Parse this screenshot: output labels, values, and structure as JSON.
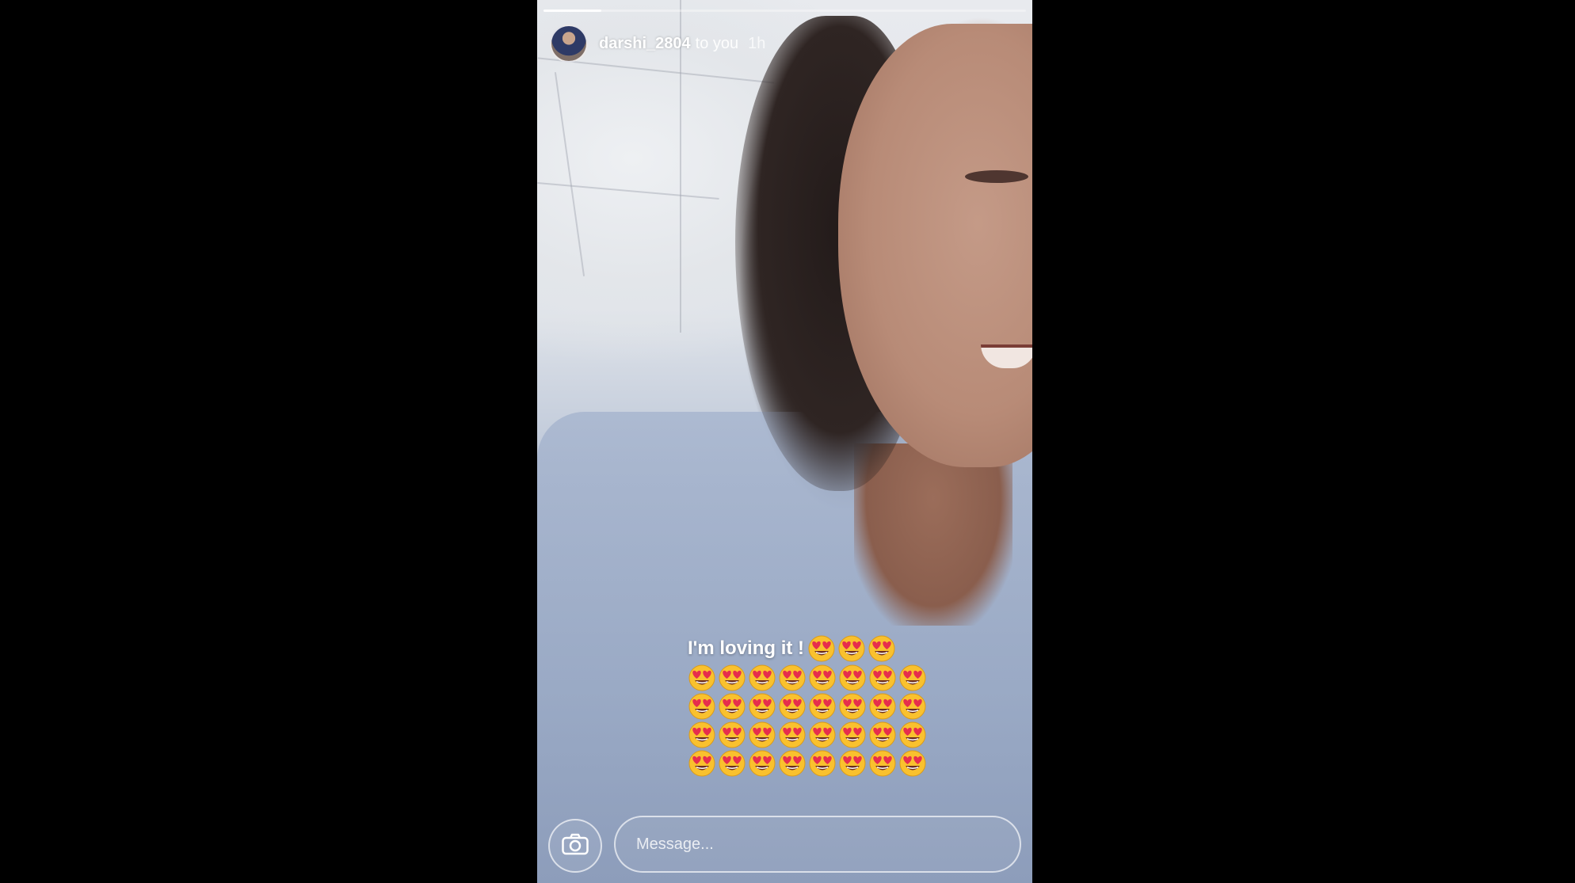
{
  "story": {
    "progress_fraction": 0.12,
    "user": {
      "username": "darshi_2804",
      "audience": "to you",
      "time_ago": "1h"
    },
    "caption": {
      "text": "I'm loving it !",
      "emoji": "heart-eyes",
      "emoji_rows": [
        3,
        8,
        8,
        8,
        8
      ]
    },
    "message": {
      "placeholder": "Message..."
    }
  },
  "colors": {
    "emoji_face": "#F9C12E",
    "emoji_heart": "#E62E4D",
    "text": "#FFFFFF"
  }
}
